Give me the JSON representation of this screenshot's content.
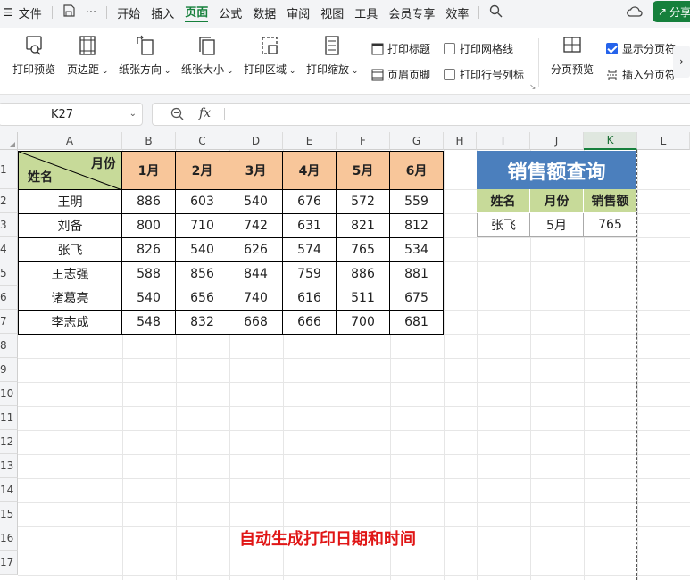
{
  "menubar": {
    "items": [
      "文件",
      "开始",
      "插入",
      "页面",
      "公式",
      "数据",
      "审阅",
      "视图",
      "工具",
      "会员专享",
      "效率"
    ],
    "active": "页面",
    "share_label": "分享"
  },
  "ribbon": {
    "buttons": [
      "打印预览",
      "页边距",
      "纸张方向",
      "纸张大小",
      "打印区域",
      "打印缩放",
      "分页预览",
      "插入分页符"
    ],
    "small_buttons": [
      "打印标题",
      "页眉页脚"
    ],
    "checkboxes": [
      {
        "label": "打印网格线",
        "checked": false
      },
      {
        "label": "打印行号列标",
        "checked": false
      },
      {
        "label": "显示分页符",
        "checked": true
      }
    ]
  },
  "formula_bar": {
    "cell_ref": "K27",
    "fx": "fx",
    "value": ""
  },
  "columns": [
    "A",
    "B",
    "C",
    "D",
    "E",
    "F",
    "G",
    "H",
    "I",
    "J",
    "K",
    "L"
  ],
  "selected_column": "K",
  "rows": [
    "1",
    "2",
    "3",
    "4",
    "5",
    "6",
    "7",
    "8",
    "9",
    "10",
    "11",
    "12",
    "13",
    "14",
    "15",
    "16",
    "17"
  ],
  "sales_table": {
    "corner_top": "月份",
    "corner_bottom": "姓名",
    "months": [
      "1月",
      "2月",
      "3月",
      "4月",
      "5月",
      "6月"
    ],
    "rows": [
      {
        "name": "王明",
        "values": [
          886,
          603,
          540,
          676,
          572,
          559
        ]
      },
      {
        "name": "刘备",
        "values": [
          800,
          710,
          742,
          631,
          821,
          812
        ]
      },
      {
        "name": "张飞",
        "values": [
          826,
          540,
          626,
          574,
          765,
          534
        ]
      },
      {
        "name": "王志强",
        "values": [
          588,
          856,
          844,
          759,
          886,
          881
        ]
      },
      {
        "name": "诸葛亮",
        "values": [
          540,
          656,
          740,
          616,
          511,
          675
        ]
      },
      {
        "name": "李志成",
        "values": [
          548,
          832,
          668,
          666,
          700,
          681
        ]
      }
    ]
  },
  "query_table": {
    "title": "销售额查询",
    "headers": [
      "姓名",
      "月份",
      "销售额"
    ],
    "values": [
      "张飞",
      "5月",
      "765"
    ]
  },
  "note": "自动生成打印日期和时间",
  "colors": {
    "accent": "#16803c",
    "month_header": "#f8c69a",
    "name_header": "#c7da99",
    "query_title": "#4b7fbd",
    "note": "#e01616"
  }
}
